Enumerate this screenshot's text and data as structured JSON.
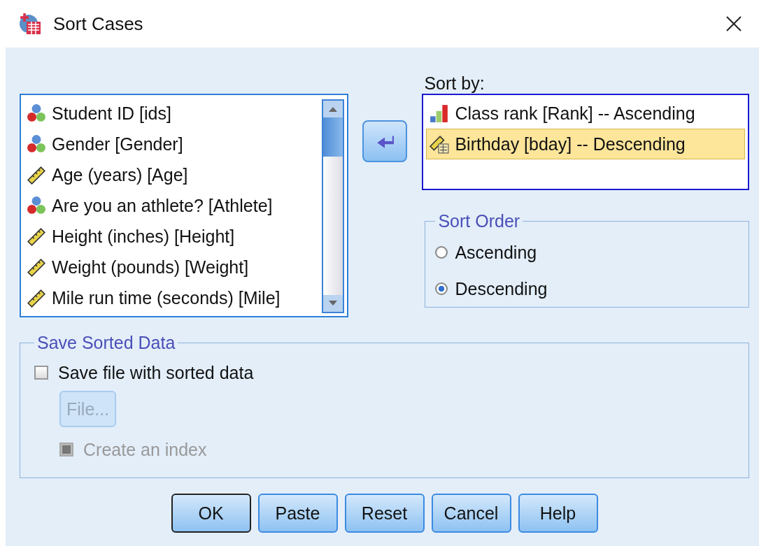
{
  "window": {
    "title": "Sort Cases"
  },
  "variables": [
    {
      "label": "Student ID [ids]",
      "kind": "nominal",
      "selected": false
    },
    {
      "label": "Gender [Gender]",
      "kind": "nominal",
      "selected": false
    },
    {
      "label": "Age (years) [Age]",
      "kind": "scale",
      "selected": false
    },
    {
      "label": "Are you an athlete? [Athlete]",
      "kind": "nominal",
      "selected": false
    },
    {
      "label": "Height (inches) [Height]",
      "kind": "scale",
      "selected": false
    },
    {
      "label": "Weight (pounds) [Weight]",
      "kind": "scale",
      "selected": false
    },
    {
      "label": "Mile run time (seconds) [Mile]",
      "kind": "scale",
      "selected": false
    }
  ],
  "sort_by": {
    "label": "Sort by:",
    "items": [
      {
        "label": "Class rank [Rank] -- Ascending",
        "kind": "ordinal",
        "selected": false
      },
      {
        "label": "Birthday [bday] -- Descending",
        "kind": "date",
        "selected": true
      }
    ]
  },
  "sort_order": {
    "title": "Sort Order",
    "options": [
      {
        "label": "Ascending",
        "selected": false
      },
      {
        "label": "Descending",
        "selected": true
      }
    ]
  },
  "save_sorted_data": {
    "title": "Save Sorted Data",
    "save_file": {
      "label": "Save file with sorted data",
      "checked": false
    },
    "file_button": {
      "label": "File...",
      "disabled": true
    },
    "create_index": {
      "label": "Create an index",
      "disabled": true
    }
  },
  "buttons": [
    {
      "label": "OK",
      "default": true
    },
    {
      "label": "Paste",
      "default": false
    },
    {
      "label": "Reset",
      "default": false
    },
    {
      "label": "Cancel",
      "default": false
    },
    {
      "label": "Help",
      "default": false
    }
  ]
}
